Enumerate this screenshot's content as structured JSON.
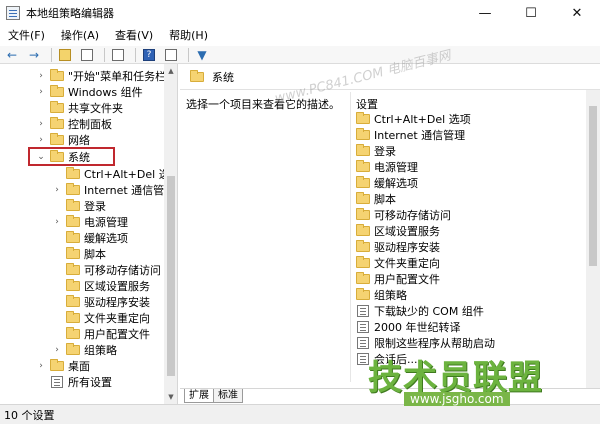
{
  "window": {
    "title": "本地组策略编辑器",
    "minimize": "—",
    "maximize": "☐",
    "close": "✕"
  },
  "menu": [
    "文件(F)",
    "操作(A)",
    "查看(V)",
    "帮助(H)"
  ],
  "toolbar": {
    "back": "←",
    "forward": "→",
    "help": "?",
    "filter": "▼"
  },
  "tree": {
    "items": [
      {
        "label": "\"开始\"菜单和任务栏",
        "expander": "›"
      },
      {
        "label": "Windows 组件",
        "expander": "›"
      },
      {
        "label": "共享文件夹",
        "expander": ""
      },
      {
        "label": "控制面板",
        "expander": "›"
      },
      {
        "label": "网络",
        "expander": "›"
      },
      {
        "label": "系统",
        "expander": "⌄"
      },
      {
        "label": "Ctrl+Alt+Del 选项",
        "expander": ""
      },
      {
        "label": "Internet 通信管理",
        "expander": "›"
      },
      {
        "label": "登录",
        "expander": ""
      },
      {
        "label": "电源管理",
        "expander": "›"
      },
      {
        "label": "缓解选项",
        "expander": ""
      },
      {
        "label": "脚本",
        "expander": ""
      },
      {
        "label": "可移动存储访问",
        "expander": ""
      },
      {
        "label": "区域设置服务",
        "expander": ""
      },
      {
        "label": "驱动程序安装",
        "expander": ""
      },
      {
        "label": "文件夹重定向",
        "expander": ""
      },
      {
        "label": "用户配置文件",
        "expander": ""
      },
      {
        "label": "组策略",
        "expander": "›"
      },
      {
        "label": "桌面",
        "expander": "›"
      },
      {
        "label": "所有设置",
        "expander": ""
      }
    ]
  },
  "right": {
    "header": "系统",
    "description": "选择一个项目来查看它的描述。",
    "column": "设置",
    "items": [
      "Ctrl+Alt+Del 选项",
      "Internet 通信管理",
      "登录",
      "电源管理",
      "缓解选项",
      "脚本",
      "可移动存储访问",
      "区域设置服务",
      "驱动程序安装",
      "文件夹重定向",
      "用户配置文件",
      "组策略",
      "下载缺少的 COM 组件",
      "2000 年世纪转译",
      "限制这些程序从帮助启动",
      "会话后..."
    ],
    "tabs": [
      "扩展",
      "标准"
    ]
  },
  "status": "10 个设置",
  "watermark": {
    "top": "www.PC841.COM 电脑百事网",
    "logo": "技术员联盟",
    "url": "www.jsgho.com"
  }
}
